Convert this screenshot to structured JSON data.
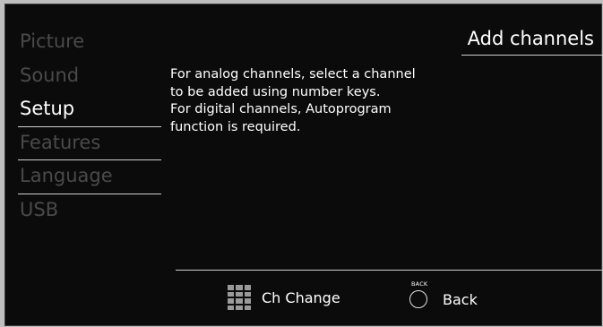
{
  "menu": {
    "items": [
      {
        "label": "Picture",
        "active": false
      },
      {
        "label": "Sound",
        "active": false
      },
      {
        "label": "Setup",
        "active": true
      },
      {
        "label": "Features",
        "active": false
      },
      {
        "label": "Language",
        "active": false
      },
      {
        "label": "USB",
        "active": false
      }
    ]
  },
  "panel": {
    "title": "Add channels",
    "description_lines": [
      "For analog channels, select a channel",
      "to be added using number keys.",
      "For digital channels, Autoprogram",
      "function is required."
    ]
  },
  "footer": {
    "ch_change_label": "Ch Change",
    "ch_change_icon": "keypad-icon",
    "back_key_label": "BACK",
    "back_label": "Back",
    "back_icon": "back-button-icon"
  },
  "colors": {
    "background": "#0b0b0b",
    "active_text": "#ffffff",
    "inactive_text": "#4a4a4a",
    "rule": "#cfcfcf"
  }
}
